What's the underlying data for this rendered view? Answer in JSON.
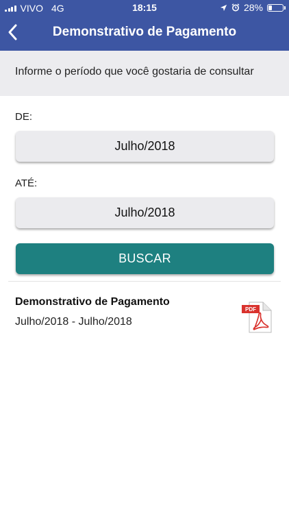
{
  "status_bar": {
    "carrier": "VIVO",
    "network": "4G",
    "time": "18:15",
    "battery": "28%",
    "battery_level": 0.28
  },
  "nav": {
    "title": "Demonstrativo de Pagamento",
    "back_icon": "chevron-left-icon"
  },
  "instruction": "Informe o período que você gostaria de consultar",
  "form": {
    "from_label": "DE:",
    "from_value": "Julho/2018",
    "to_label": "ATÉ:",
    "to_value": "Julho/2018",
    "search_button": "BUSCAR"
  },
  "results": [
    {
      "title": "Demonstrativo de Pagamento",
      "period": "Julho/2018 - Julho/2018",
      "icon": "pdf-icon",
      "badge": "PDF"
    }
  ],
  "colors": {
    "header": "#3d56a3",
    "button": "#1e8080",
    "pdf_red": "#d9322d"
  }
}
